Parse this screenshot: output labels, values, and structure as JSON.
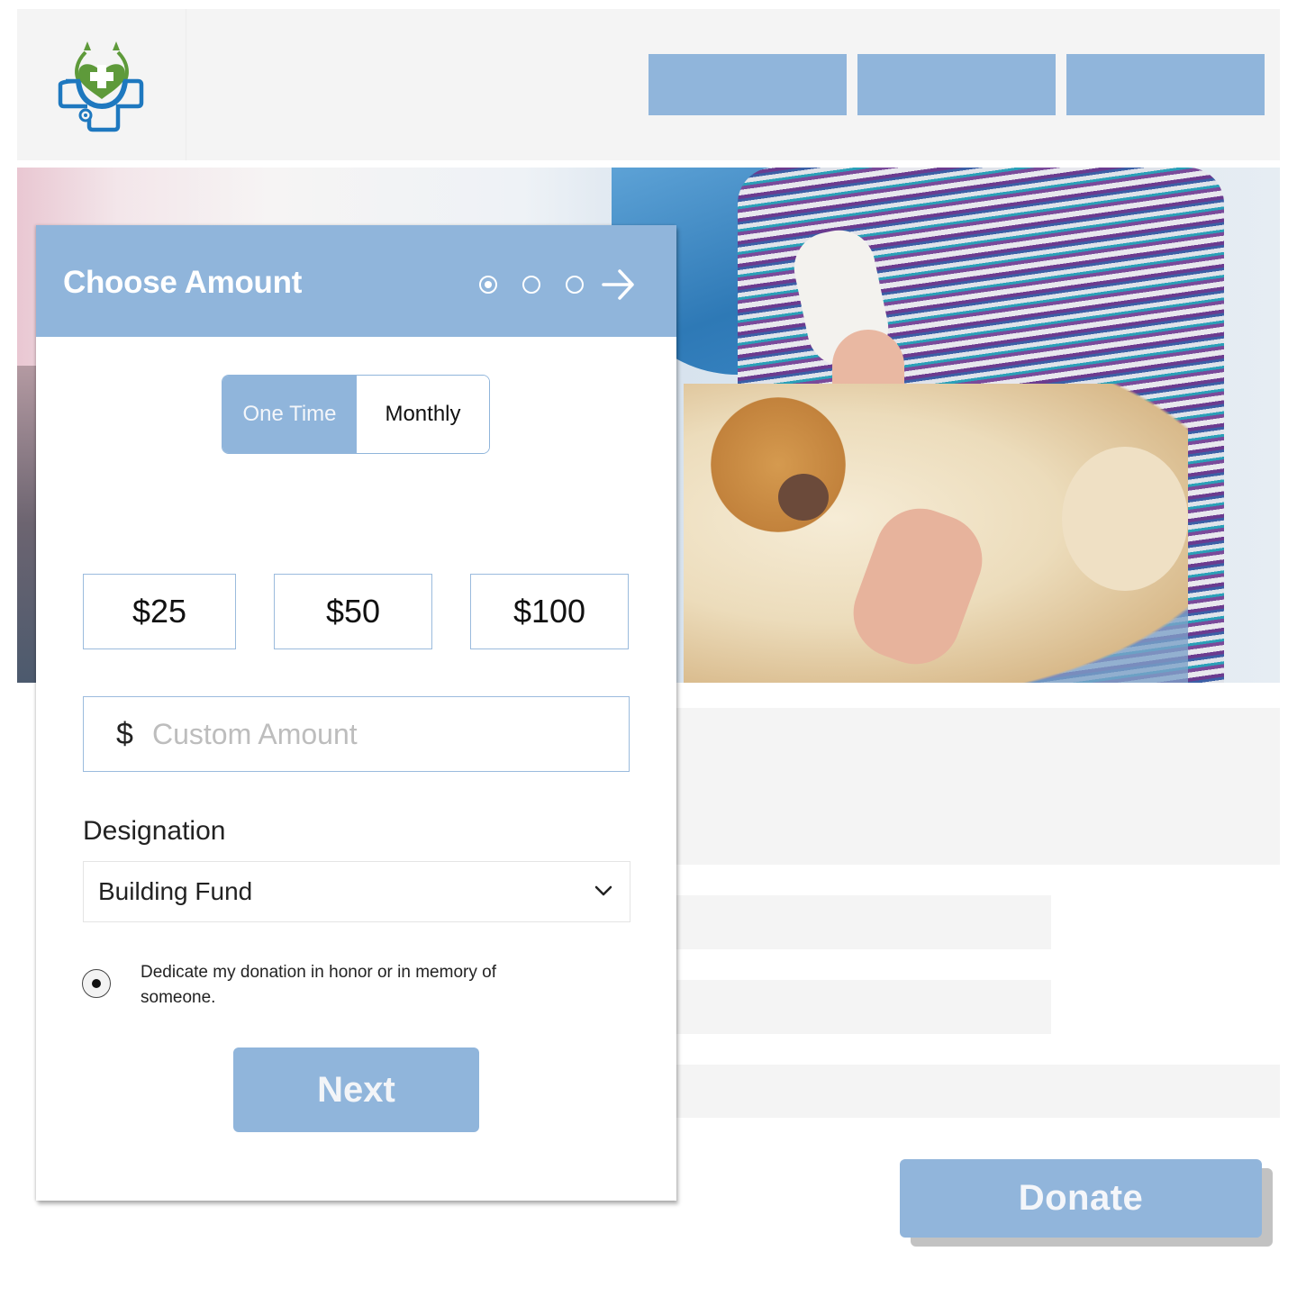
{
  "header": {
    "logo_name": "medical-heart-stethoscope-logo",
    "nav_buttons": [
      "",
      "",
      ""
    ]
  },
  "hero": {
    "image_description": "Child with bandaged arm holding a teddy bear"
  },
  "donation_form": {
    "title": "Choose Amount",
    "steps": {
      "total": 3,
      "current": 1
    },
    "frequency": {
      "options": [
        "One Time",
        "Monthly"
      ],
      "selected": "One Time"
    },
    "amounts": [
      "$25",
      "$50",
      "$100"
    ],
    "custom_amount": {
      "currency_symbol": "$",
      "placeholder": "Custom Amount",
      "value": ""
    },
    "designation": {
      "label": "Designation",
      "selected": "Building Fund"
    },
    "dedicate": {
      "label": "Dedicate my donation in honor or in memory of someone.",
      "checked": true
    },
    "next_label": "Next"
  },
  "page": {
    "donate_label": "Donate"
  },
  "colors": {
    "accent": "#90b5db",
    "header_bg": "#f4f4f4",
    "placeholder_block": "#f4f4f4",
    "logo_green": "#5e9a3a",
    "logo_blue": "#1e78bf"
  }
}
